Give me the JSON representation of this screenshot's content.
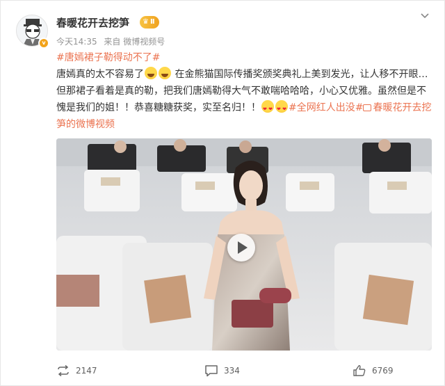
{
  "post": {
    "username": "春暖花开去挖笋",
    "level": "Ⅱ",
    "time": "今天14:35",
    "source": "来自 微博视频号",
    "topic": "#唐嫣裙子勒得动不了#",
    "text_line1_a": "唐嫣真的太不容易了",
    "text_line1_b": "在金熊猫国际传播奖颁奖典礼上美到发光，让人移不开眼…",
    "text_line2": "但那裙子看着是真的勒，把我们唐嫣勒得大气不敢喘哈哈哈，小心又优雅。虽然但是不",
    "text_line3_a": "愧是我们的姐！！恭喜糖糖获奖，实至名归！！",
    "topic2": "#全网红人出没#",
    "video_link_a": "春暖花开去挖",
    "video_link_b": "笋的微博视频"
  },
  "actions": {
    "repost_count": "2147",
    "comment_count": "334",
    "like_count": "6769"
  },
  "icons": {
    "more": "chevron-down-icon",
    "repost": "repost-icon",
    "comment": "comment-icon",
    "like": "thumbs-up-icon",
    "play": "play-icon"
  },
  "colors": {
    "link": "#eb7350",
    "text": "#333333",
    "meta": "#939393",
    "badge": "#f0a21f"
  }
}
